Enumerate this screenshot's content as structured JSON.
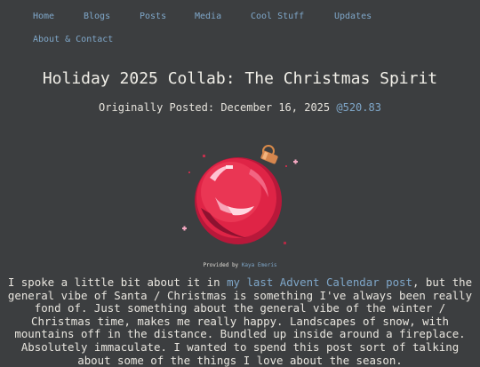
{
  "nav": {
    "items": [
      "Home",
      "Blogs",
      "Posts",
      "Media",
      "Cool Stuff",
      "Updates",
      "About & Contact"
    ]
  },
  "post": {
    "title": "Holiday 2025 Collab: The Christmas Spirit",
    "posted_label": "Originally Posted: December 16, 2025",
    "posted_beat": "@520.83"
  },
  "image": {
    "icon": "christmas-ornament-pixel-art",
    "credit_prefix": "Provided by",
    "credit_name": "Kaya Emeris"
  },
  "body": {
    "text_before_link": "I spoke a little bit about it in ",
    "link_text": "my last Advent Calendar post",
    "text_after_link": ", but the general vibe of Santa / Christmas is something I've always been really fond of. Just something about the general vibe of the winter / Christmas time, makes me really happy. Landscapes of snow, with mountains off in the distance. Bundled up inside around a fireplace. Absolutely immaculate. I wanted to spend this post sort of talking about some of the things I love about the season."
  },
  "colors": {
    "background": "#3c3e40",
    "link": "#7fa7c9",
    "text": "#eceae4",
    "ornament": "#e3223f"
  }
}
